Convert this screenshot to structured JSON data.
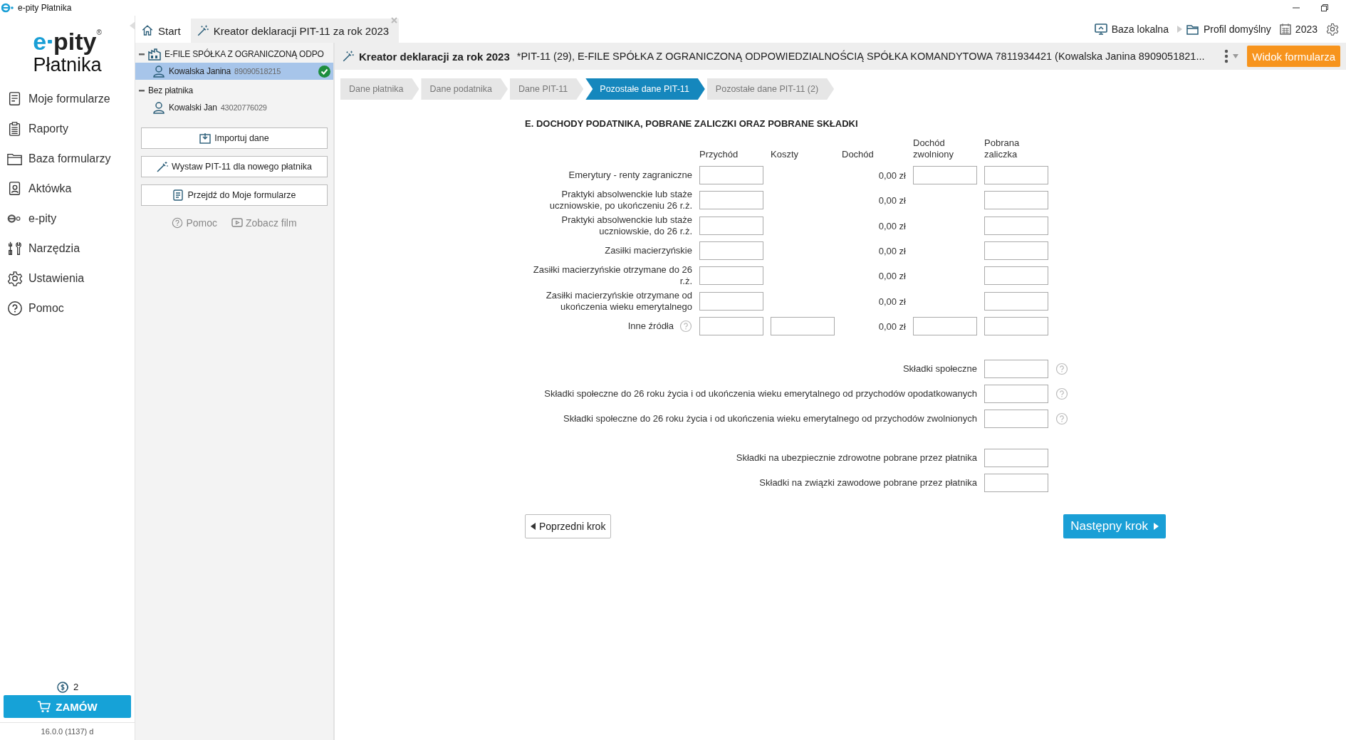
{
  "window": {
    "title": "e-pity Płatnika"
  },
  "sidebar": {
    "logo": {
      "prefix": "e",
      "name": "pity",
      "mark": "®",
      "subtitle": "Płatnika"
    },
    "items": [
      {
        "label": "Moje formularze"
      },
      {
        "label": "Raporty"
      },
      {
        "label": "Baza formularzy"
      },
      {
        "label": "Aktówka"
      },
      {
        "label": "e-pity"
      },
      {
        "label": "Narzędzia"
      },
      {
        "label": "Ustawienia"
      },
      {
        "label": "Pomoc"
      }
    ],
    "credits": "2",
    "order_button": "ZAMÓW",
    "version": "16.0.0 (1137) d"
  },
  "tabs": [
    {
      "label": "Start",
      "selected": false,
      "closable": false
    },
    {
      "label": "Kreator deklaracji PIT-11 za rok 2023",
      "selected": true,
      "closable": true
    }
  ],
  "toolbar": {
    "database": "Baza lokalna",
    "profile": "Profil domyślny",
    "year": "2023"
  },
  "tree": [
    {
      "label": "E-FILE SPÓŁKA Z OGRANICZONĄ ODPO",
      "kind": "company",
      "expanded": true,
      "children": [
        {
          "label": "Kowalska Janina",
          "number": "89090518215",
          "selected": true,
          "verified": true
        }
      ]
    },
    {
      "label": "Bez płatnika",
      "kind": "group",
      "expanded": true,
      "children": [
        {
          "label": "Kowalski Jan",
          "number": "43020776029",
          "selected": false,
          "verified": false
        }
      ]
    }
  ],
  "panel_buttons": [
    {
      "label": "Importuj dane"
    },
    {
      "label": "Wystaw PIT-11 dla nowego płatnika"
    },
    {
      "label": "Przejdź do Moje formularze"
    }
  ],
  "panel_links": [
    {
      "label": "Pomoc"
    },
    {
      "label": "Zobacz film"
    }
  ],
  "header": {
    "title": "Kreator deklaracji za rok 2023",
    "subtitle": "*PIT-11 (29), E-FILE SPÓŁKA Z OGRANICZONĄ ODPOWIEDZIALNOŚCIĄ SPÓŁKA KOMANDYTOWA 7811934421 (Kowalska Janina 8909051821...",
    "view_button": "Widok formularza"
  },
  "steps": [
    {
      "label": "Dane płatnika",
      "selected": false
    },
    {
      "label": "Dane podatnika",
      "selected": false
    },
    {
      "label": "Dane PIT-11",
      "selected": false
    },
    {
      "label": "Pozostałe dane PIT-11",
      "selected": true
    },
    {
      "label": "Pozostałe dane PIT-11 (2)",
      "selected": false
    }
  ],
  "form": {
    "title": "E. DOCHODY PODATNIKA, POBRANE ZALICZKI ORAZ POBRANE SKŁADKI",
    "columns": [
      "Przychód",
      "Koszty",
      "Dochód",
      "Dochód zwolniony",
      "Pobrana zaliczka"
    ],
    "rows": [
      {
        "label": "Emerytury - renty zagraniczne",
        "help": false,
        "costs_field": false,
        "exempt_field": true,
        "income": "0,00 zł"
      },
      {
        "label": "Praktyki absolwenckie lub staże uczniowskie, po ukończeniu 26 r.ż.",
        "help": false,
        "costs_field": false,
        "exempt_field": false,
        "income": "0,00 zł"
      },
      {
        "label": "Praktyki absolwenckie lub staże uczniowskie, do 26 r.ż.",
        "help": false,
        "costs_field": false,
        "exempt_field": false,
        "income": "0,00 zł"
      },
      {
        "label": "Zasiłki macierzyńskie",
        "help": false,
        "costs_field": false,
        "exempt_field": false,
        "income": "0,00 zł"
      },
      {
        "label": "Zasiłki macierzyńskie otrzymane do 26 r.ż.",
        "help": false,
        "costs_field": false,
        "exempt_field": false,
        "income": "0,00 zł"
      },
      {
        "label": "Zasiłki macierzyńskie otrzymane od ukończenia wieku emerytalnego",
        "help": false,
        "costs_field": false,
        "exempt_field": false,
        "income": "0,00 zł"
      },
      {
        "label": "Inne źródła",
        "help": true,
        "costs_field": true,
        "exempt_field": true,
        "income": "0,00 zł"
      }
    ],
    "social_contributions": [
      {
        "label": "Składki społeczne",
        "help": true
      },
      {
        "label": "Składki społeczne do 26 roku życia i od ukończenia wieku emerytalnego od przychodów opodatkowanych",
        "help": true
      },
      {
        "label": "Składki społeczne do 26 roku życia i od ukończenia wieku emerytalnego od przychodów zwolnionych",
        "help": true
      }
    ],
    "other_contributions": [
      {
        "label": "Składki na ubezpiecznie zdrowotne pobrane przez płatnika",
        "help": false
      },
      {
        "label": "Składki na związki zawodowe pobrane przez płatnika",
        "help": false
      }
    ],
    "prev_button": "Poprzedni krok",
    "next_button": "Następny krok"
  }
}
